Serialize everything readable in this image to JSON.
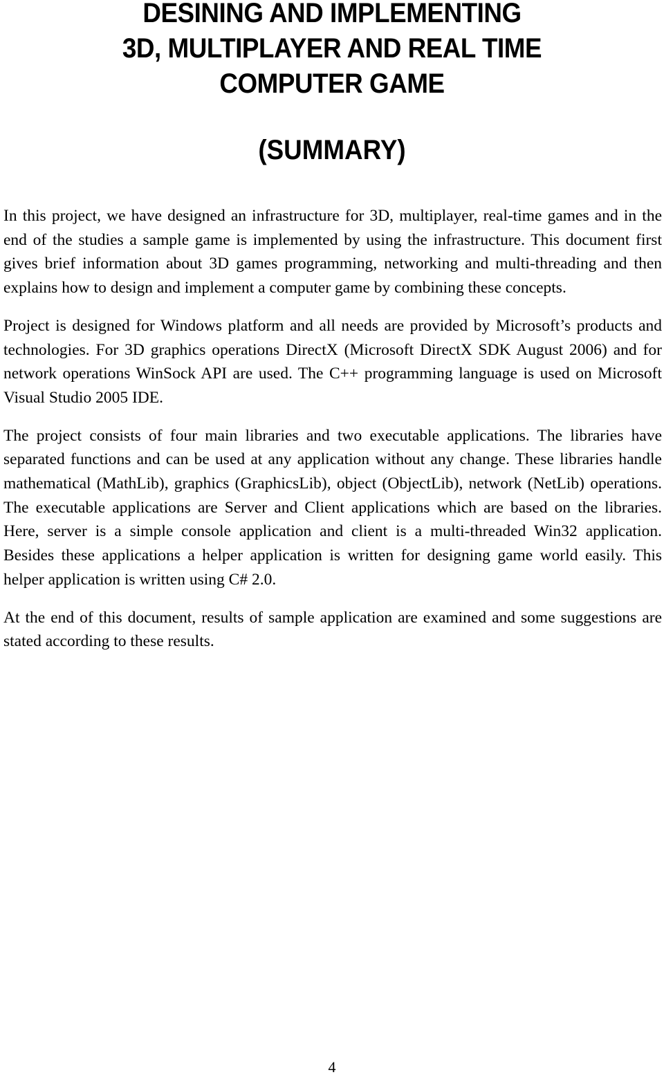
{
  "document": {
    "title_lines": [
      "DESINING AND IMPLEMENTING",
      "3D, MULTIPLAYER AND REAL TIME",
      "COMPUTER GAME"
    ],
    "subtitle": "(SUMMARY)",
    "paragraphs": [
      "In this project, we have designed an infrastructure for 3D, multiplayer, real-time games and in the end of the studies a sample game is implemented by using the infrastructure. This document first gives brief information about 3D games programming, networking and multi-threading and then explains how to design and implement a computer game by combining these concepts.",
      "Project is designed for Windows platform and all needs are provided by Microsoft’s products and technologies. For 3D graphics operations DirectX (Microsoft DirectX SDK August 2006) and for network operations WinSock API are used. The C++ programming language is used on Microsoft Visual Studio 2005 IDE.",
      "The project consists of four main libraries and two executable applications. The libraries have separated functions and can be used at any application without any change. These libraries handle mathematical (MathLib), graphics (GraphicsLib), object (ObjectLib), network (NetLib) operations. The executable applications are Server and Client applications which are based on the libraries. Here, server is a simple console application and client is a multi-threaded Win32 application. Besides these applications a helper application is written for designing game world easily. This helper application is written using C# 2.0.",
      "At the end of this document, results of sample application are examined and some suggestions are stated according to these results."
    ],
    "page_number": "4"
  }
}
